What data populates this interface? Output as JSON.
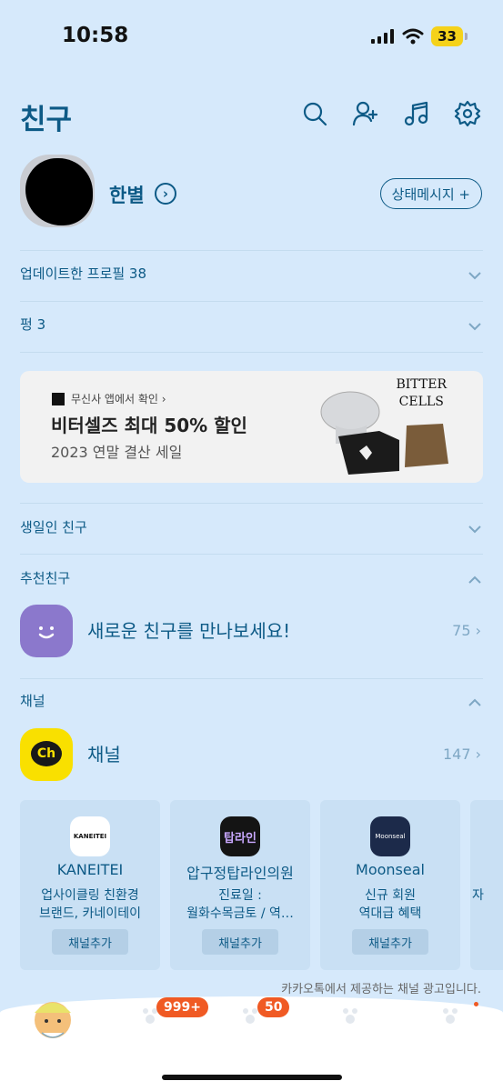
{
  "status_bar": {
    "time": "10:58",
    "battery": "33"
  },
  "header": {
    "title": "친구",
    "icons": [
      "search-icon",
      "add-friend-icon",
      "music-icon",
      "settings-icon"
    ]
  },
  "profile": {
    "name": "한별",
    "status_button": "상태메시지 +"
  },
  "rows": {
    "updated_profiles": "업데이트한 프로필 38",
    "pung": "펑 3"
  },
  "ad": {
    "brand": "무신사 앱에서 확인 ›",
    "headline": "비터셀즈 최대 50% 할인",
    "sub": "2023 연말 결산 세일",
    "logo_text_line1": "BITTER",
    "logo_text_line2": "CELLS"
  },
  "sections": {
    "birthday": "생일인 친구",
    "recommend": "추천친구",
    "recommend_text": "새로운 친구를 만나보세요!",
    "recommend_count": "75 ›",
    "channel_header": "채널",
    "channel_text": "채널",
    "channel_count": "147 ›",
    "channel_icon_text": "Ch"
  },
  "channel_cards": [
    {
      "name": "KANEITEI",
      "logo": "KANEITEI",
      "desc": "업사이클링 친환경\n브랜드, 카네이테이",
      "button": "채널추가"
    },
    {
      "name": "압구정탑라인의원",
      "logo": "탑라인",
      "desc": "진료일 :\n월화수목금토 / 역…",
      "button": "채널추가"
    },
    {
      "name": "Moonseal",
      "logo": "Moonseal",
      "desc": "신규 회원\n역대급 혜택",
      "button": "채널추가"
    },
    {
      "name": "",
      "logo": "",
      "desc": "자",
      "button": ""
    }
  ],
  "ad_notice": "카카오톡에서 제공하는 채널 광고입니다.",
  "tabbar": {
    "badge_chats": "999+",
    "badge_openchat": "50"
  },
  "colors": {
    "background": "#d6e9fb",
    "accent": "#0d5a86",
    "badge": "#f05a24",
    "channel_yellow": "#f9e000"
  }
}
